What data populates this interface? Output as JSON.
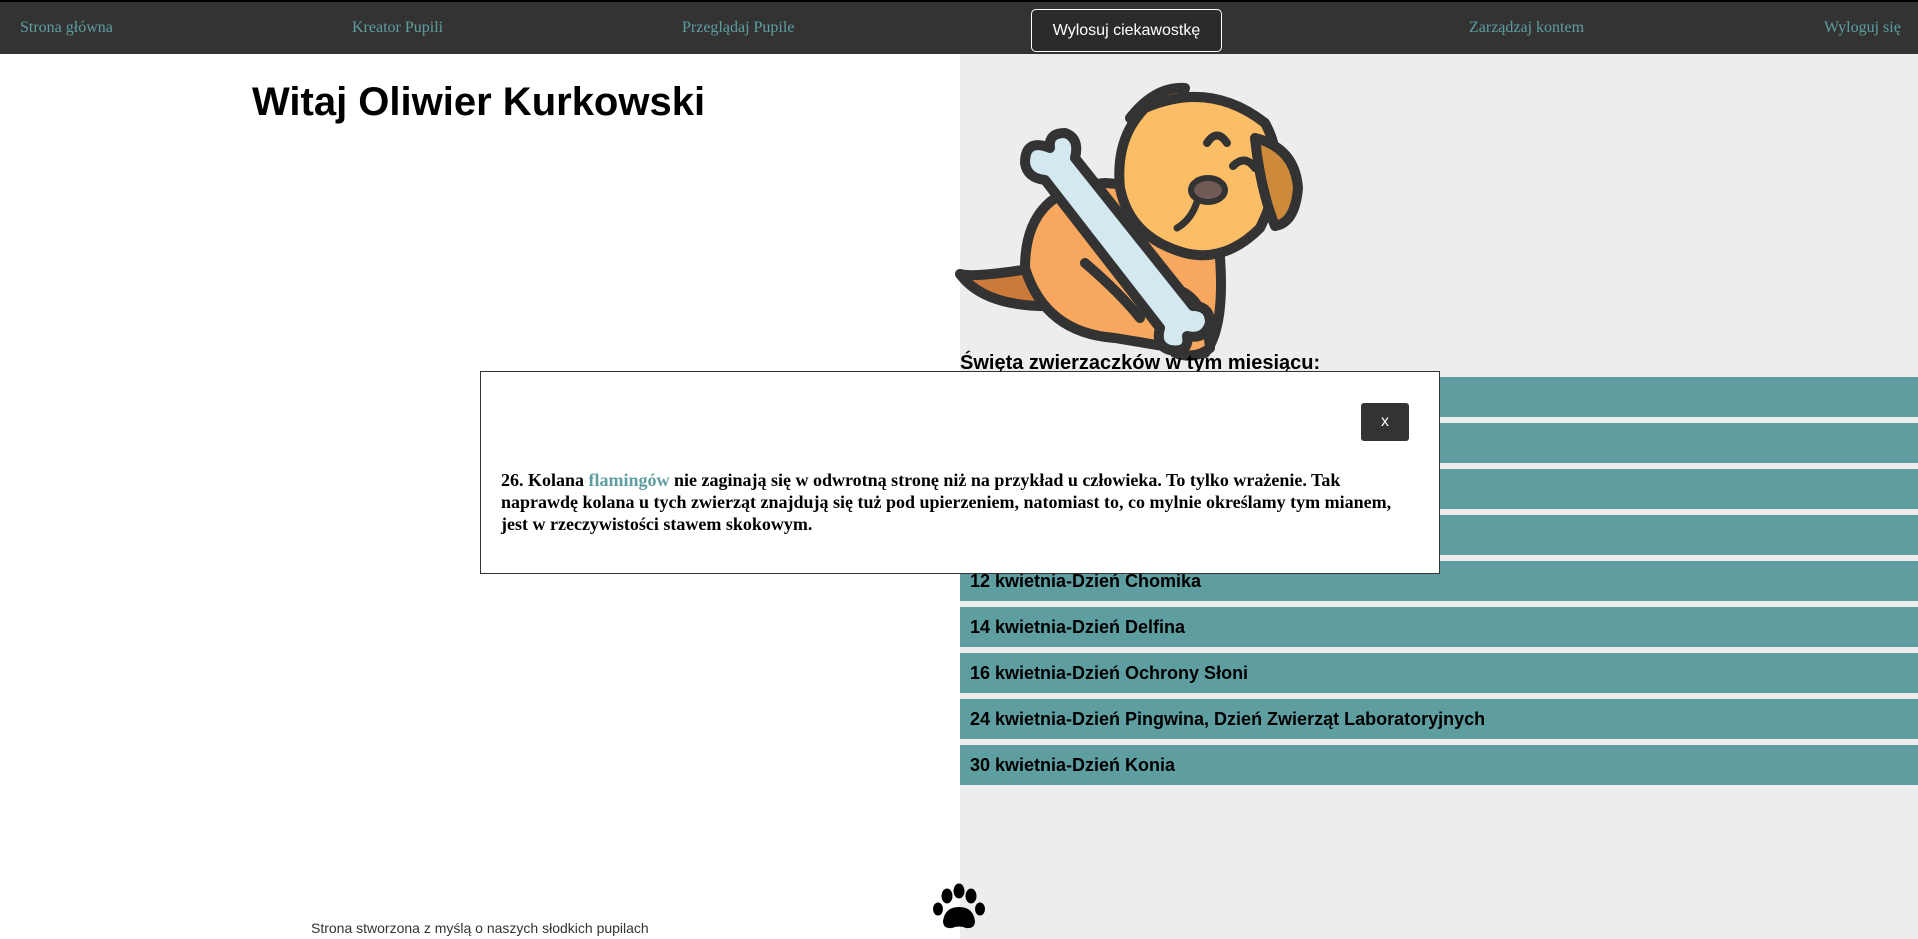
{
  "nav": {
    "home": "Strona główna",
    "creator": "Kreator Pupili",
    "browse": "Przeglądaj Pupile",
    "draw_fact": "Wylosuj ciekawostkę",
    "account": "Zarządzaj kontem",
    "logout": "Wyloguj się"
  },
  "welcome": "Witaj Oliwier Kurkowski",
  "holidays": {
    "title": "Święta zwierzaczków w tym miesiącu:",
    "items": [
      "",
      "",
      "",
      "",
      "12 kwietnia-Dzień Chomika",
      "14 kwietnia-Dzień Delfina",
      "16 kwietnia-Dzień Ochrony Słoni",
      "24 kwietnia-Dzień Pingwina, Dzień Zwierząt Laboratoryjnych",
      "30 kwietnia-Dzień Konia"
    ]
  },
  "modal": {
    "close_label": "x",
    "text_before": "26. Kolana ",
    "highlight": "flamingów",
    "text_after": " nie zaginają się w odwrotną stronę niż na przykład u człowieka. To tylko wrażenie. Tak naprawdę kolana u tych zwierząt znajdują się tuż pod upierzeniem, natomiast to, co mylnie określamy tym mianem, jest w rzeczywistości stawem skokowym."
  },
  "footer": {
    "text": "Strona stworzona z myślą o naszych słodkich pupilach"
  },
  "icons": {
    "mascot": "dog-with-bone-icon",
    "footer": "paw-icon"
  },
  "colors": {
    "nav_bg": "#333333",
    "accent": "#5f9ea0",
    "right_panel_bg": "#ededed"
  }
}
